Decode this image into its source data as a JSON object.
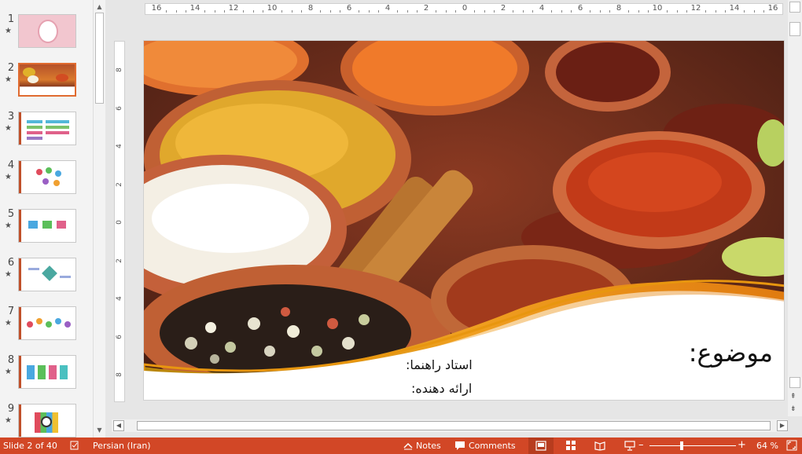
{
  "thumbnails": [
    {
      "num": "1",
      "star": "★"
    },
    {
      "num": "2",
      "star": "★"
    },
    {
      "num": "3",
      "star": "★"
    },
    {
      "num": "4",
      "star": "★"
    },
    {
      "num": "5",
      "star": "★"
    },
    {
      "num": "6",
      "star": "★"
    },
    {
      "num": "7",
      "star": "★"
    },
    {
      "num": "8",
      "star": "★"
    },
    {
      "num": "9",
      "star": "★"
    }
  ],
  "ruler": {
    "horizontal": [
      "16",
      "14",
      "12",
      "10",
      "8",
      "6",
      "4",
      "2",
      "0",
      "2",
      "4",
      "6",
      "8",
      "10",
      "12",
      "14",
      "16"
    ],
    "vertical": [
      "8",
      "6",
      "4",
      "2",
      "0",
      "2",
      "4",
      "6",
      "8"
    ]
  },
  "slide": {
    "topic": "موضوع:",
    "supervisor": "استاد راهنما:",
    "presenter": "ارائه دهنده:"
  },
  "status": {
    "slide_info": "Slide 2 of 40",
    "language": "Persian (Iran)",
    "notes": "Notes",
    "comments": "Comments",
    "zoom_level": "64 %",
    "zoom_minus": "–",
    "zoom_plus": "+"
  },
  "colors": {
    "accent": "#d24726",
    "selected_border": "#e06b30"
  }
}
